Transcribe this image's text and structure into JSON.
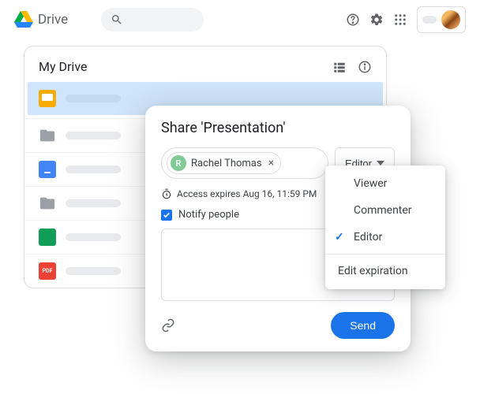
{
  "header": {
    "product": "Drive"
  },
  "drive": {
    "title": "My Drive"
  },
  "share": {
    "title": "Share 'Presentation'",
    "person_name": "Rachel Thomas",
    "person_initial": "R",
    "role_label": "Editor",
    "expiration": "Access expires Aug 16, 11:59 PM",
    "notify_label": "Notify people",
    "send_label": "Send"
  },
  "role_menu": {
    "viewer": "Viewer",
    "commenter": "Commenter",
    "editor": "Editor",
    "edit_expiration": "Edit expiration"
  }
}
